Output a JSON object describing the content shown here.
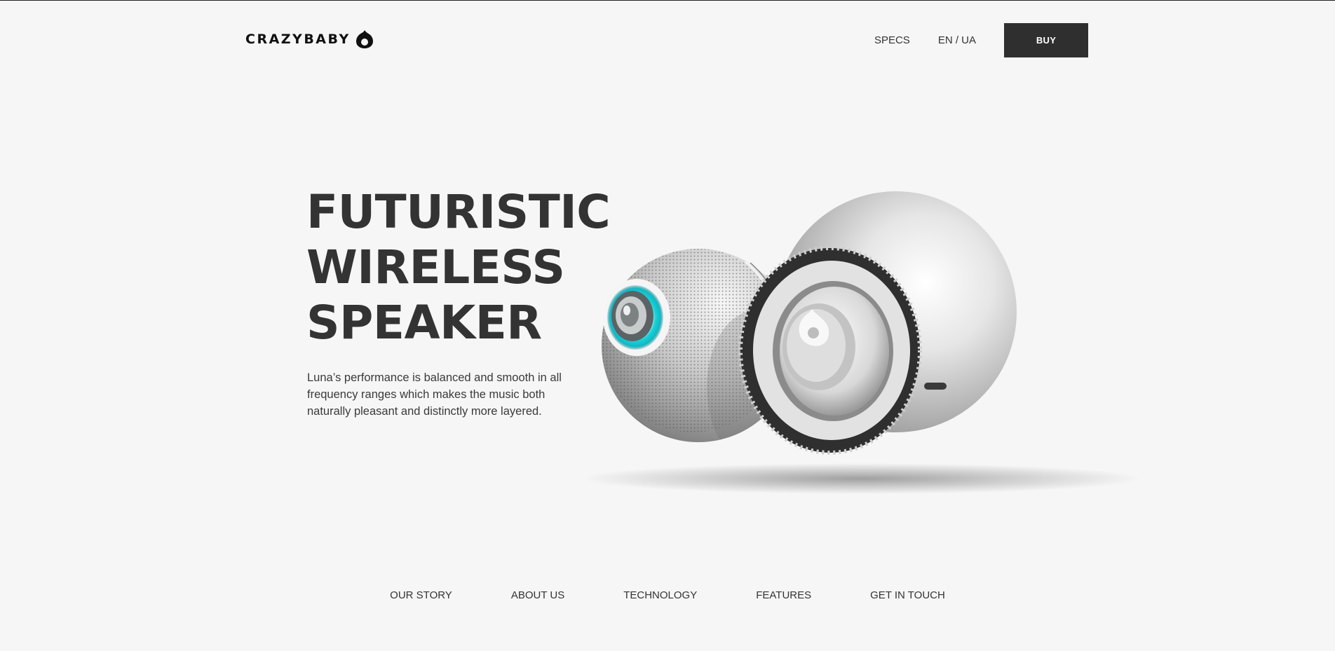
{
  "brand": {
    "name": "CRAZYBABY",
    "logo_icon": "drop-logo-icon"
  },
  "header": {
    "specs_label": "SPECS",
    "lang_label": "EN / UA",
    "buy_label": "BUY"
  },
  "hero": {
    "title_lines": [
      "FUTURISTIC",
      "WIRELESS",
      "SPEAKER"
    ],
    "description": "Luna’s performance is balanced and smooth in all frequency ranges which makes the music both naturally pleasant and distinctly more layered.",
    "image": "twin-spherical-speakers-image"
  },
  "footer_nav": {
    "items": [
      "OUR STORY",
      "ABOUT US",
      "TECHNOLOGY",
      "FEATURES",
      "GET IN TOUCH"
    ]
  },
  "colors": {
    "background": "#f6f6f6",
    "text": "#333333",
    "button": "#2f2f2f",
    "accent_glow": "#19d3d8"
  }
}
